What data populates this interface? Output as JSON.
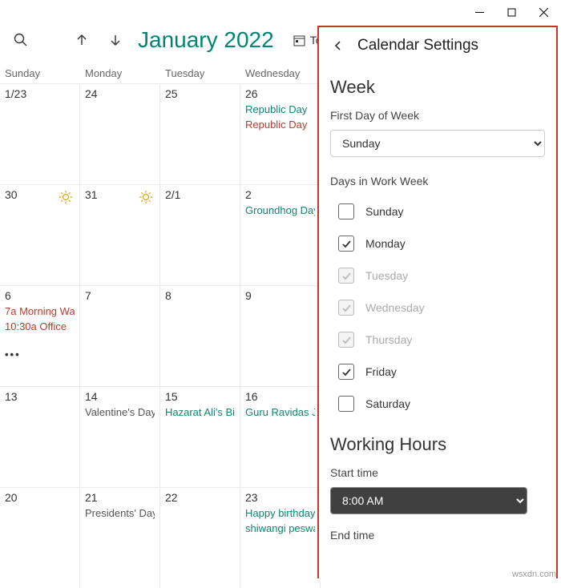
{
  "window": {
    "min": "—",
    "max": "▢",
    "close": "✕"
  },
  "toolbar": {
    "month_title": "January 2022",
    "today_label": "Today"
  },
  "dayheads": [
    "Sunday",
    "Monday",
    "Tuesday",
    "Wednesday"
  ],
  "weeks": [
    {
      "days": [
        {
          "date": "1/23",
          "events": []
        },
        {
          "date": "24",
          "events": []
        },
        {
          "date": "25",
          "events": []
        },
        {
          "date": "26",
          "events": [
            {
              "text": "Republic Day",
              "cls": "teal"
            },
            {
              "text": "Republic Day",
              "cls": "red"
            }
          ]
        }
      ]
    },
    {
      "days": [
        {
          "date": "30",
          "events": [],
          "sun": true
        },
        {
          "date": "31",
          "events": [],
          "sun": true
        },
        {
          "date": "2/1",
          "events": []
        },
        {
          "date": "2",
          "events": [
            {
              "text": "Groundhog Day",
              "cls": "teal"
            }
          ]
        }
      ]
    },
    {
      "days": [
        {
          "date": "6",
          "events": [
            {
              "text": "7a Morning Wa",
              "cls": "red"
            },
            {
              "text": "10:30a Office",
              "cls": "red"
            }
          ],
          "more": true
        },
        {
          "date": "7",
          "events": []
        },
        {
          "date": "8",
          "events": []
        },
        {
          "date": "9",
          "events": []
        }
      ]
    },
    {
      "days": [
        {
          "date": "13",
          "events": []
        },
        {
          "date": "14",
          "events": [
            {
              "text": "Valentine's Day",
              "cls": "dark"
            }
          ]
        },
        {
          "date": "15",
          "events": [
            {
              "text": "Hazarat Ali's Bi",
              "cls": "teal"
            }
          ]
        },
        {
          "date": "16",
          "events": [
            {
              "text": "Guru Ravidas Ja",
              "cls": "teal"
            }
          ]
        }
      ]
    },
    {
      "days": [
        {
          "date": "20",
          "events": []
        },
        {
          "date": "21",
          "events": [
            {
              "text": "Presidents' Day",
              "cls": "dark"
            }
          ]
        },
        {
          "date": "22",
          "events": []
        },
        {
          "date": "23",
          "events": [
            {
              "text": "Happy birthday",
              "cls": "teal"
            },
            {
              "text": "shiwangi peswa",
              "cls": "teal"
            }
          ]
        }
      ]
    }
  ],
  "settings": {
    "title": "Calendar Settings",
    "week_section": "Week",
    "first_day_label": "First Day of Week",
    "first_day_value": "Sunday",
    "days_in_ww_label": "Days in Work Week",
    "days": [
      {
        "label": "Sunday",
        "checked": false,
        "disabled": false
      },
      {
        "label": "Monday",
        "checked": true,
        "disabled": false
      },
      {
        "label": "Tuesday",
        "checked": true,
        "disabled": true
      },
      {
        "label": "Wednesday",
        "checked": true,
        "disabled": true
      },
      {
        "label": "Thursday",
        "checked": true,
        "disabled": true
      },
      {
        "label": "Friday",
        "checked": true,
        "disabled": false
      },
      {
        "label": "Saturday",
        "checked": false,
        "disabled": false
      }
    ],
    "working_hours_section": "Working Hours",
    "start_time_label": "Start time",
    "start_time_value": "8:00 AM",
    "end_time_label": "End time"
  },
  "watermark": "wsxdn.com"
}
